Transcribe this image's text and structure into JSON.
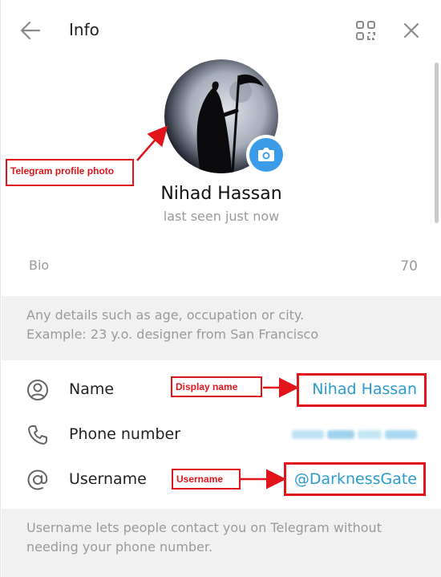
{
  "header": {
    "title": "Info"
  },
  "profile": {
    "name": "Nihad Hassan",
    "status": "last seen just now"
  },
  "bio": {
    "label": "Bio",
    "char_count": "70",
    "hint_lines": [
      "Any details such as age, occupation or city.",
      "Example: 23 y.o. designer from San Francisco"
    ]
  },
  "fields": {
    "name": {
      "label": "Name",
      "value": "Nihad Hassan"
    },
    "phone": {
      "label": "Phone number"
    },
    "username": {
      "label": "Username",
      "value": "@DarknessGate"
    }
  },
  "username_hint": {
    "lines": [
      "Username lets people contact you on Telegram without",
      "needing your phone number."
    ]
  },
  "annotations": {
    "profile_photo": "Telegram profile photo",
    "display_name": "Display name",
    "username": "Username"
  },
  "colors": {
    "accent": "#2a9bcf",
    "camera_button": "#3a9be8",
    "annotation": "#e0141a"
  }
}
